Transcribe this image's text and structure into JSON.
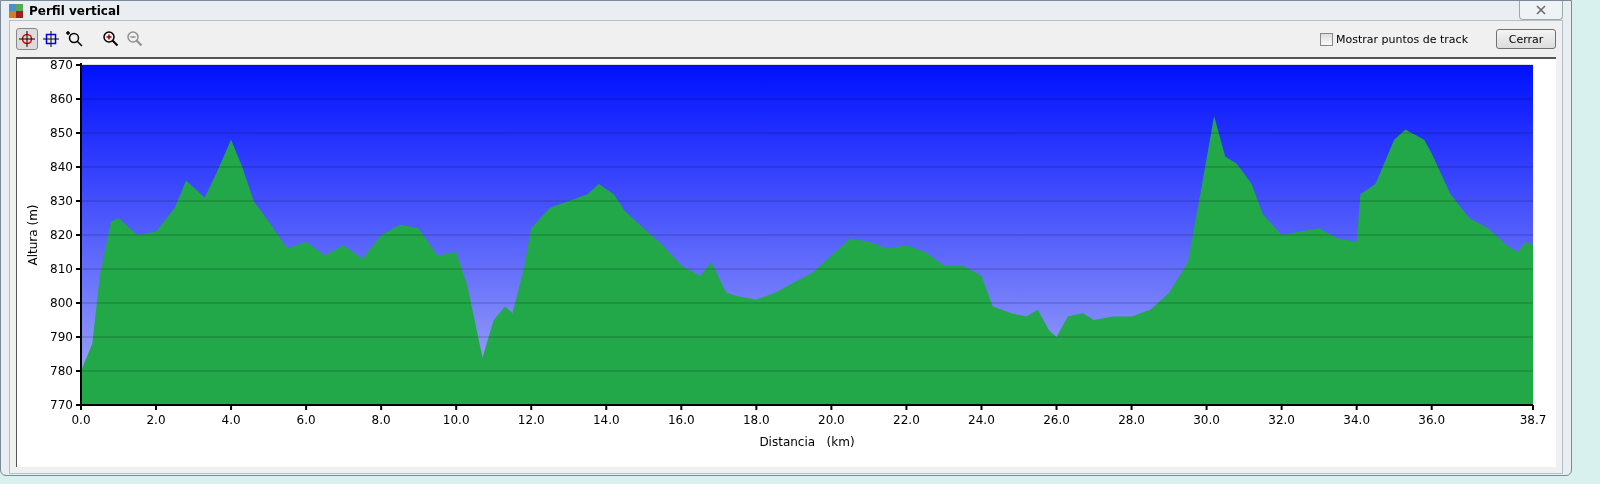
{
  "window": {
    "title": "Perfil vertical"
  },
  "toolbar": {
    "tools": [
      {
        "selected": true,
        "disabled": false
      },
      {
        "selected": false,
        "disabled": false
      },
      {
        "selected": false,
        "disabled": false
      },
      {
        "selected": false,
        "disabled": false
      },
      {
        "selected": false,
        "disabled": true
      }
    ],
    "show_points": {
      "label": "Mostrar puntos de track",
      "checked": false
    },
    "close_button": "Cerrar"
  },
  "chart_data": {
    "type": "area",
    "xlabel": "Distancia   (km)",
    "ylabel": "Altura (m)",
    "xlim": [
      0,
      38.7
    ],
    "ylim": [
      770,
      870
    ],
    "xticks": [
      {
        "value": 0,
        "label": "0.0"
      },
      {
        "value": 2,
        "label": "2.0"
      },
      {
        "value": 4,
        "label": "4.0"
      },
      {
        "value": 6,
        "label": "6.0"
      },
      {
        "value": 8,
        "label": "8.0"
      },
      {
        "value": 10,
        "label": "10.0"
      },
      {
        "value": 12,
        "label": "12.0"
      },
      {
        "value": 14,
        "label": "14.0"
      },
      {
        "value": 16,
        "label": "16.0"
      },
      {
        "value": 18,
        "label": "18.0"
      },
      {
        "value": 20,
        "label": "20.0"
      },
      {
        "value": 22,
        "label": "22.0"
      },
      {
        "value": 24,
        "label": "24.0"
      },
      {
        "value": 26,
        "label": "26.0"
      },
      {
        "value": 28,
        "label": "28.0"
      },
      {
        "value": 30,
        "label": "30.0"
      },
      {
        "value": 32,
        "label": "32.0"
      },
      {
        "value": 34,
        "label": "34.0"
      },
      {
        "value": 36,
        "label": "36.0"
      },
      {
        "value": 38.7,
        "label": "38.7"
      }
    ],
    "yticks": [
      770,
      780,
      790,
      800,
      810,
      820,
      830,
      840,
      850,
      860,
      870
    ],
    "x": [
      0,
      0.3,
      0.5,
      0.8,
      1,
      1.2,
      1.5,
      2,
      2.5,
      2.8,
      3,
      3.3,
      3.6,
      4,
      4.3,
      4.6,
      5,
      5.5,
      6,
      6.5,
      7,
      7.5,
      8,
      8.5,
      9,
      9.5,
      10,
      10.3,
      10.7,
      11,
      11.3,
      11.5,
      11.8,
      12,
      12.5,
      13,
      13.5,
      13.8,
      14.2,
      14.5,
      15,
      15.5,
      16,
      16.5,
      16.8,
      17.2,
      17.5,
      18,
      18.5,
      19,
      19.5,
      20,
      20.5,
      21,
      21.5,
      22,
      22.5,
      23,
      23.5,
      24,
      24.3,
      24.8,
      25.2,
      25.5,
      25.8,
      26,
      26.3,
      26.7,
      27,
      27.5,
      28,
      28.5,
      29,
      29.5,
      29.8,
      30.2,
      30.5,
      30.8,
      31.2,
      31.5,
      32,
      32.5,
      33,
      33.5,
      34,
      34.1,
      34.5,
      35,
      35.3,
      35.8,
      36,
      36.5,
      37,
      37.5,
      38,
      38.3,
      38.5,
      38.7
    ],
    "grid": true,
    "series": [
      {
        "color": "#22a848",
        "values": [
          780,
          788,
          808,
          824,
          825,
          823,
          820,
          821,
          828,
          836,
          834,
          831,
          838,
          848,
          840,
          830,
          824,
          816,
          818,
          814,
          817,
          813,
          820,
          823,
          822,
          814,
          815,
          805,
          784,
          795,
          799,
          797,
          810,
          822,
          828,
          830,
          832,
          835,
          832,
          827,
          822,
          817,
          811,
          808,
          812,
          803,
          802,
          801,
          803,
          806,
          809,
          814,
          819,
          818,
          816,
          817,
          815,
          811,
          811,
          808,
          799,
          797,
          796,
          798,
          792,
          790,
          796,
          797,
          795,
          796,
          796,
          798,
          803,
          812,
          830,
          855,
          843,
          841,
          835,
          826,
          820,
          821,
          822,
          819,
          818,
          832,
          835,
          848,
          851,
          848,
          844,
          832,
          825,
          822,
          817,
          815,
          818,
          817
        ]
      }
    ]
  }
}
